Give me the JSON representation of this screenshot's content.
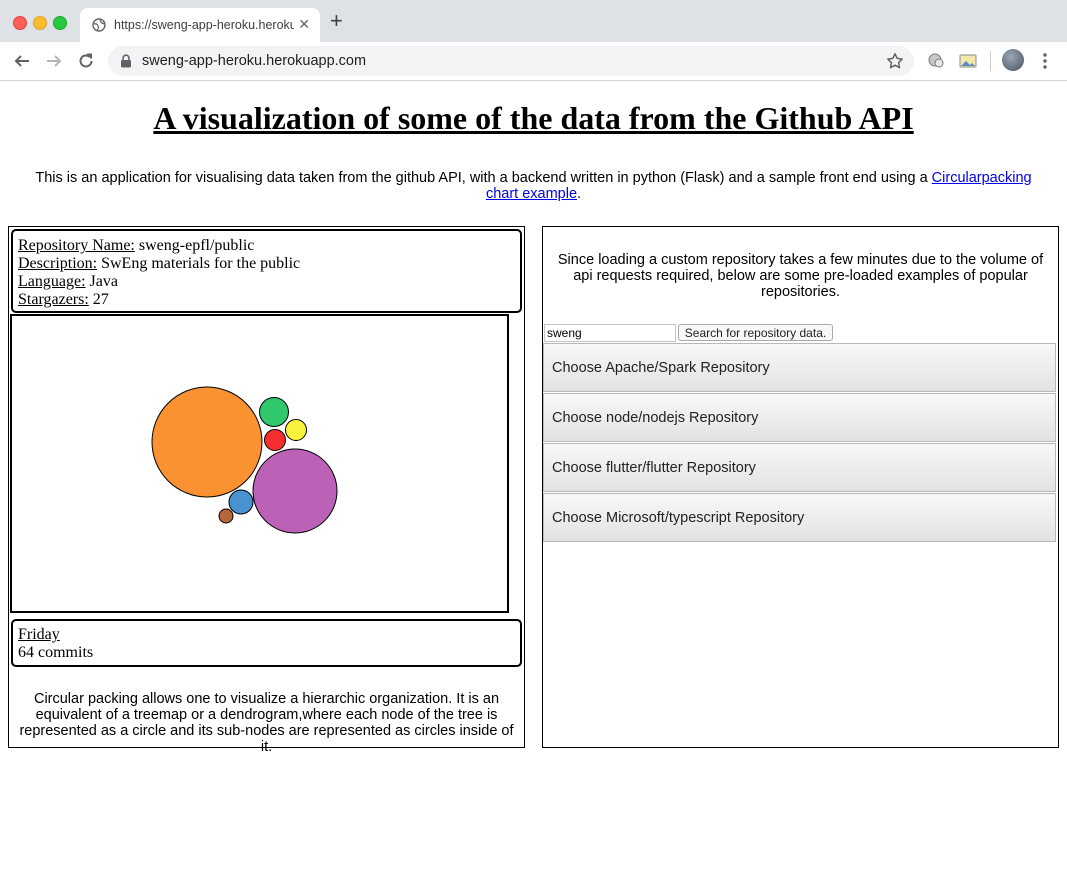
{
  "browser": {
    "tab_title": "https://sweng-app-heroku.herokuapp.com",
    "url": "sweng-app-heroku.herokuapp.com"
  },
  "page": {
    "title": "A visualization of some of the data from the Github API",
    "intro_text": "This is an application for visualising data taken from the github API, with a backend written in python (Flask) and a sample front end using a ",
    "intro_link": "Circularpacking chart example",
    "intro_end": "."
  },
  "repo_info": {
    "name_label": "Repository Name:",
    "name_value": " sweng-epfl/public",
    "description_label": "Description:",
    "description_value": " SwEng materials for the public",
    "language_label": "Language:",
    "language_value": " Java",
    "stargazers_label": "Stargazers:",
    "stargazers_value": " 27"
  },
  "chart_data": {
    "type": "circle-packing",
    "nodes": [
      {
        "name": "",
        "color": "#fb9232"
      },
      {
        "name": "",
        "color": "#bb61b6"
      },
      {
        "name": "",
        "color": "#2fc86c"
      },
      {
        "name": "",
        "color": "#f8f33b"
      },
      {
        "name": "",
        "color": "#f52f2f"
      },
      {
        "name": "",
        "color": "#4a91cf"
      },
      {
        "name": "",
        "color": "#b5673a"
      }
    ]
  },
  "tooltip": {
    "day": "Friday",
    "commits": "64 commits"
  },
  "description": "Circular packing allows one to visualize a hierarchic organization. It is an equivalent of a treemap or a dendrogram,where each node of the tree is represented as a circle and its sub-nodes are represented as circles inside of it.",
  "right_panel": {
    "notice": "Since loading a custom repository takes a few minutes due to the volume of api requests required, below are some pre-loaded examples of popular repositories.",
    "search_value": "sweng",
    "search_button": "Search for repository data.",
    "repo_buttons": [
      "Choose Apache/Spark Repository",
      "Choose node/nodejs Repository",
      "Choose flutter/flutter Repository",
      "Choose Microsoft/typescript Repository"
    ]
  }
}
